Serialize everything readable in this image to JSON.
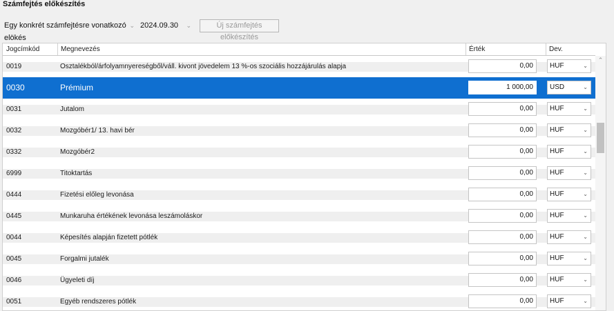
{
  "page_title": "Számfejtés előkészítés",
  "toolbar": {
    "type_select": "Egy konkrét számfejtésre vonatkozó elökés",
    "date_select": "2024.09.30",
    "new_button": "Új számfejtés előkészítés"
  },
  "columns": {
    "code": "Jogcímkód",
    "name": "Megnevezés",
    "value": "Érték",
    "currency": "Dev."
  },
  "rows": [
    {
      "code": "0019",
      "name": "Osztalékból/árfolyamnyereségből/váll. kivont jövedelem 13 %-os szociális hozzájárulás alapja",
      "value": "0,00",
      "currency": "HUF"
    },
    {
      "code": "0030",
      "name": "Prémium",
      "value": "1 000,00",
      "currency": "USD"
    },
    {
      "code": "0031",
      "name": "Jutalom",
      "value": "0,00",
      "currency": "HUF"
    },
    {
      "code": "0032",
      "name": "Mozgóbér1/ 13. havi bér",
      "value": "0,00",
      "currency": "HUF"
    },
    {
      "code": "0332",
      "name": "Mozgóbér2",
      "value": "0,00",
      "currency": "HUF"
    },
    {
      "code": "6999",
      "name": "Titoktartás",
      "value": "0,00",
      "currency": "HUF"
    },
    {
      "code": "0444",
      "name": "Fizetési előleg levonása",
      "value": "0,00",
      "currency": "HUF"
    },
    {
      "code": "0445",
      "name": "Munkaruha értékének levonása leszámoláskor",
      "value": "0,00",
      "currency": "HUF"
    },
    {
      "code": "0044",
      "name": "Képesítés alapján fizetett pótlék",
      "value": "0,00",
      "currency": "HUF"
    },
    {
      "code": "0045",
      "name": "Forgalmi jutalék",
      "value": "0,00",
      "currency": "HUF"
    },
    {
      "code": "0046",
      "name": "Ügyeleti díj",
      "value": "0,00",
      "currency": "HUF"
    },
    {
      "code": "0051",
      "name": "Egyéb rendszeres pótlék",
      "value": "0,00",
      "currency": "HUF"
    }
  ],
  "selected_row": 1,
  "colors": {
    "selection": "#0f6fd0"
  }
}
